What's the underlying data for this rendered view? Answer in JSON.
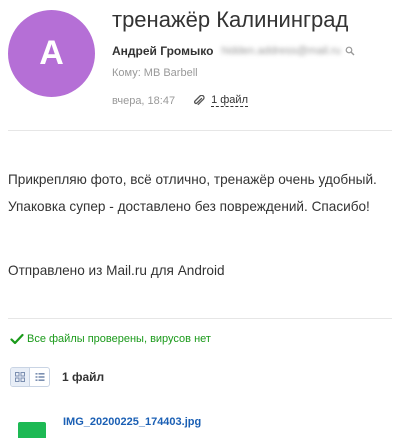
{
  "message": {
    "avatar_letter": "A",
    "subject": "тренажёр Калининград",
    "sender_name": "Андрей Громыко",
    "sender_email": "hidden.address@mail.ru",
    "to_label": "Кому:",
    "to_value": "MB Barbell",
    "date": "вчера, 18:47",
    "files_link": "1 файл",
    "body_paragraph": "Прикрепляю фото, всё отлично, тренажёр очень удобный. Упаковка супер -  доставлено без повреждений. Спасибо!",
    "signature": "Отправлено из Mail.ru для Android"
  },
  "attachments": {
    "scan_status": "Все файлы проверены, вирусов нет",
    "count_label": "1 файл",
    "files": [
      {
        "name": "IMG_20200225_174403.jpg"
      }
    ]
  },
  "colors": {
    "avatar_bg": "#b56fd6",
    "link": "#1a5fb4",
    "success": "#1a9a1a",
    "thumb": "#1db954"
  },
  "icons": [
    "search-icon",
    "paperclip-icon",
    "check-icon",
    "grid-view-icon",
    "list-view-icon"
  ]
}
